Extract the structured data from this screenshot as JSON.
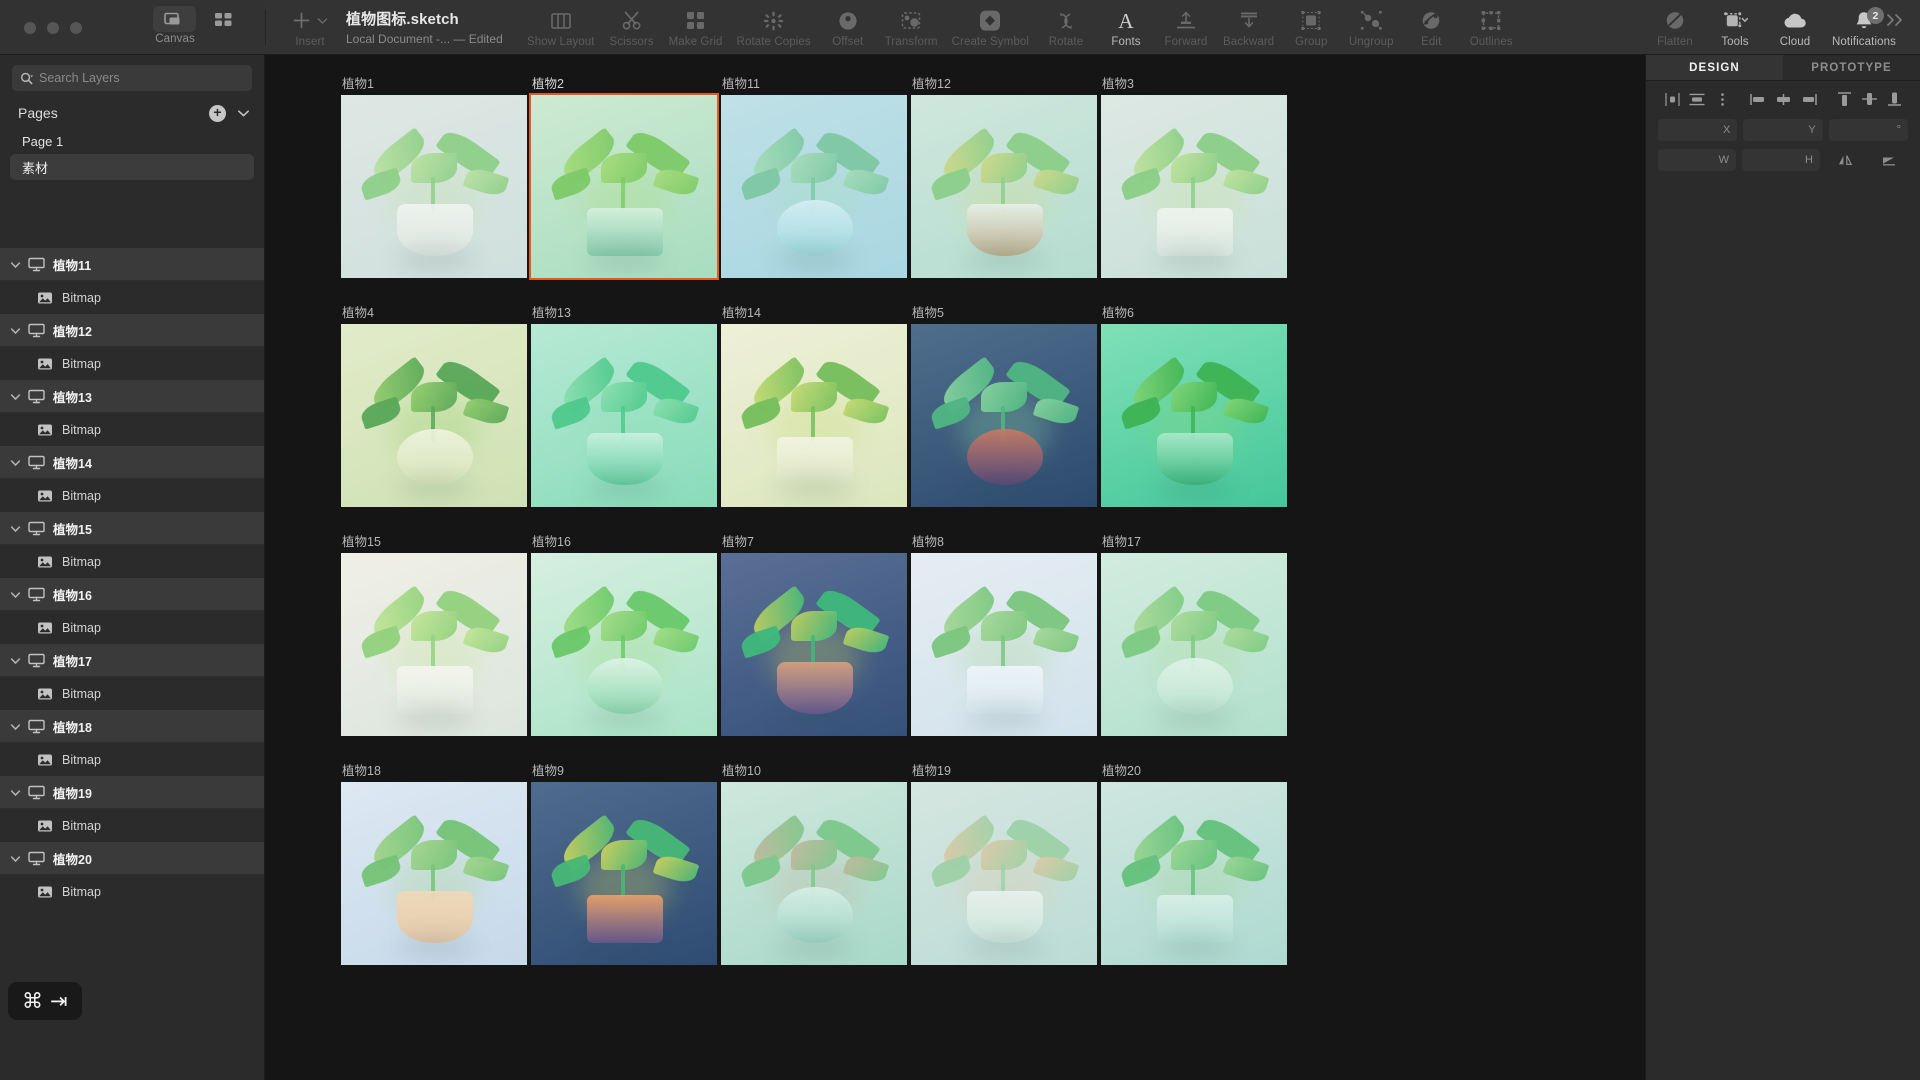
{
  "window": {
    "traffic_lights": [
      "close",
      "minimize",
      "zoom"
    ],
    "canvas_toggle_label": "Canvas"
  },
  "document": {
    "name": "植物图标.sketch",
    "subtitle": "Local Document -... — Edited"
  },
  "toolbar": {
    "insert_label": "Insert",
    "items": [
      {
        "label": "Show Layout",
        "icon": "layout-columns-icon",
        "state": "dim"
      },
      {
        "label": "Scissors",
        "icon": "scissors-icon",
        "state": "dim"
      },
      {
        "label": "Make Grid",
        "icon": "grid-squares-icon",
        "state": "dim"
      },
      {
        "label": "Rotate Copies",
        "icon": "rotate-copies-icon",
        "state": "dim"
      },
      {
        "label": "Offset",
        "icon": "offset-disc-icon",
        "state": "dim"
      },
      {
        "label": "Transform",
        "icon": "transform-icon",
        "state": "dim"
      },
      {
        "label": "Create Symbol",
        "icon": "create-symbol-icon",
        "state": "dim"
      },
      {
        "label": "Rotate",
        "icon": "rotate-arrows-icon",
        "state": "dim"
      },
      {
        "label": "Fonts",
        "icon": "fonts-a-icon",
        "state": "bright"
      },
      {
        "label": "Forward",
        "icon": "move-forward-icon",
        "state": "dim"
      },
      {
        "label": "Backward",
        "icon": "move-backward-icon",
        "state": "dim"
      },
      {
        "label": "Group",
        "icon": "group-icon",
        "state": "dim"
      },
      {
        "label": "Ungroup",
        "icon": "ungroup-icon",
        "state": "dim"
      },
      {
        "label": "Edit",
        "icon": "edit-icon",
        "state": "dim"
      },
      {
        "label": "Outlines",
        "icon": "outlines-icon",
        "state": "dim"
      },
      {
        "label": "Flatten",
        "icon": "flatten-icon",
        "state": "dim"
      },
      {
        "label": "Tools",
        "icon": "tools-icon",
        "state": "bright"
      },
      {
        "label": "Cloud",
        "icon": "cloud-icon",
        "state": "bright"
      },
      {
        "label": "Notifications",
        "icon": "bell-icon",
        "state": "bright",
        "badge": "2"
      }
    ],
    "overflow_icon": "chevron-double-right-icon"
  },
  "sidebar": {
    "search": {
      "placeholder": "Search Layers",
      "icon": "search-icon",
      "value": ""
    },
    "pages": {
      "title": "Pages",
      "add_icon": "plus-circle-icon",
      "collapse_icon": "chevron-down-icon",
      "items": [
        {
          "label": "Page 1",
          "selected": false
        },
        {
          "label": "素材",
          "selected": true
        }
      ]
    },
    "layers": [
      {
        "type": "artboard",
        "label": "植物11"
      },
      {
        "type": "bitmap",
        "label": "Bitmap"
      },
      {
        "type": "artboard",
        "label": "植物12"
      },
      {
        "type": "bitmap",
        "label": "Bitmap"
      },
      {
        "type": "artboard",
        "label": "植物13"
      },
      {
        "type": "bitmap",
        "label": "Bitmap"
      },
      {
        "type": "artboard",
        "label": "植物14"
      },
      {
        "type": "bitmap",
        "label": "Bitmap"
      },
      {
        "type": "artboard",
        "label": "植物15"
      },
      {
        "type": "bitmap",
        "label": "Bitmap"
      },
      {
        "type": "artboard",
        "label": "植物16"
      },
      {
        "type": "bitmap",
        "label": "Bitmap"
      },
      {
        "type": "artboard",
        "label": "植物17"
      },
      {
        "type": "bitmap",
        "label": "Bitmap"
      },
      {
        "type": "artboard",
        "label": "植物18"
      },
      {
        "type": "bitmap",
        "label": "Bitmap"
      },
      {
        "type": "artboard",
        "label": "植物19"
      },
      {
        "type": "bitmap",
        "label": "Bitmap"
      },
      {
        "type": "artboard",
        "label": "植物20"
      },
      {
        "type": "bitmap",
        "label": "Bitmap"
      }
    ],
    "shortcut_overlay": {
      "keys": [
        "⌘",
        "⇥"
      ]
    }
  },
  "canvas": {
    "accent_selection_color": "#e8581c",
    "background_color": "#151515",
    "artboards": [
      {
        "label": "植物1",
        "selected": false,
        "bg1": "#dfe7e4",
        "bg2": "#cfe0dd",
        "leaf": "#8fd08a",
        "leaf2": "#bfe2a8",
        "pot": "#eef3ef",
        "potdark": "#dfe8e2"
      },
      {
        "label": "植物2",
        "selected": true,
        "bg1": "#cdead2",
        "bg2": "#a8ddc0",
        "leaf": "#7ecb6a",
        "leaf2": "#a9dd7e",
        "pot": "#d5f0df",
        "potdark": "#86ccab"
      },
      {
        "label": "植物11",
        "selected": false,
        "bg1": "#bfe0e6",
        "bg2": "#a9d7e2",
        "leaf": "#7fc9a4",
        "leaf2": "#a8ddbd",
        "pot": "#d4eef2",
        "potdark": "#9fd9e0"
      },
      {
        "label": "植物12",
        "selected": false,
        "bg1": "#cfe7dd",
        "bg2": "#b5ddd0",
        "leaf": "#8ccf8c",
        "leaf2": "#d2d98a",
        "pot": "#e7f0e8",
        "potdark": "#bcae8e"
      },
      {
        "label": "植物3",
        "selected": false,
        "bg1": "#dde8e3",
        "bg2": "#c9e0d9",
        "leaf": "#8ccf88",
        "leaf2": "#c3e39f",
        "pot": "#eff4ef",
        "potdark": "#dde9e2"
      },
      {
        "label": "植物4",
        "selected": false,
        "bg1": "#e2ebc9",
        "bg2": "#cfe2b4",
        "leaf": "#5aa859",
        "leaf2": "#97cf6e",
        "pot": "#eef3dd",
        "potdark": "#d8e6bb"
      },
      {
        "label": "植物13",
        "selected": false,
        "bg1": "#b7e9d4",
        "bg2": "#88dcbb",
        "leaf": "#4fc98e",
        "leaf2": "#8fe0b2",
        "pot": "#c8f0df",
        "potdark": "#63cfa0"
      },
      {
        "label": "植物14",
        "selected": false,
        "bg1": "#eef0d8",
        "bg2": "#dbe6bd",
        "leaf": "#76bf5d",
        "leaf2": "#cbdc76",
        "pot": "#f2f4e2",
        "potdark": "#dfe8c4"
      },
      {
        "label": "植物5",
        "selected": false,
        "bg1": "#4f6d8c",
        "bg2": "#2c4a6e",
        "leaf": "#4fb684",
        "leaf2": "#8cd3a0",
        "pot": "#c87a62",
        "potdark": "#5a4a7a"
      },
      {
        "label": "植物6",
        "selected": false,
        "bg1": "#7fe0b7",
        "bg2": "#44c79a",
        "leaf": "#3eb455",
        "leaf2": "#84d777",
        "pot": "#a8e9cb",
        "potdark": "#3db97f"
      },
      {
        "label": "植物15",
        "selected": false,
        "bg1": "#f0efe7",
        "bg2": "#dce6dd",
        "leaf": "#93d27f",
        "leaf2": "#c5e69b",
        "pot": "#f4f6ef",
        "potdark": "#e4ebe0"
      },
      {
        "label": "植物16",
        "selected": false,
        "bg1": "#d6efe0",
        "bg2": "#a9e3c6",
        "leaf": "#6bc96a",
        "leaf2": "#a5de86",
        "pot": "#def3e6",
        "potdark": "#8edab0"
      },
      {
        "label": "植物7",
        "selected": false,
        "bg1": "#5a6f95",
        "bg2": "#35507a",
        "leaf": "#3fb87d",
        "leaf2": "#c9cf5e",
        "pot": "#d6a07e",
        "potdark": "#6a5a92"
      },
      {
        "label": "植物8",
        "selected": false,
        "bg1": "#e5edf2",
        "bg2": "#d2e2ec",
        "leaf": "#7cc77f",
        "leaf2": "#a8d99b",
        "pot": "#eef5f8",
        "potdark": "#d9e9f1"
      },
      {
        "label": "植物17",
        "selected": false,
        "bg1": "#d2ece0",
        "bg2": "#b2e0cc",
        "leaf": "#7ecb84",
        "leaf2": "#aedc9c",
        "pot": "#dff2e8",
        "potdark": "#bfe6d3"
      },
      {
        "label": "植物18",
        "selected": false,
        "bg1": "#dde8f2",
        "bg2": "#c6d9ea",
        "leaf": "#76c478",
        "leaf2": "#a6d68f",
        "pot": "#f0d9b8",
        "potdark": "#e8c9a8"
      },
      {
        "label": "植物9",
        "selected": false,
        "bg1": "#4f6b8e",
        "bg2": "#2e4c72",
        "leaf": "#48b877",
        "leaf2": "#d3d35e",
        "pot": "#e8a06a",
        "potdark": "#6b5a90"
      },
      {
        "label": "植物10",
        "selected": false,
        "bg1": "#cfe7dd",
        "bg2": "#a8d9c9",
        "leaf": "#7ec98c",
        "leaf2": "#c4b8a0",
        "pot": "#d8efe6",
        "potdark": "#a0d6c6"
      },
      {
        "label": "植物19",
        "selected": false,
        "bg1": "#d5e6e0",
        "bg2": "#bcdcd6",
        "leaf": "#9ed2a8",
        "leaf2": "#e0c9a8",
        "pot": "#e6f2ec",
        "potdark": "#cfe6de"
      },
      {
        "label": "植物20",
        "selected": false,
        "bg1": "#cfe6e0",
        "bg2": "#aedad0",
        "leaf": "#65c27d",
        "leaf2": "#9dd694",
        "pot": "#d9efe8",
        "potdark": "#b5e0d6"
      }
    ]
  },
  "inspector": {
    "tabs": [
      {
        "label": "DESIGN",
        "active": true
      },
      {
        "label": "PROTOTYPE",
        "active": false
      }
    ],
    "align_buttons": [
      "align-left-icon",
      "align-center-horizontal-icon",
      "distribute-icon",
      "align-start-icon",
      "align-middle-icon",
      "align-end-icon",
      "align-top-icon",
      "align-center-vertical-icon",
      "align-bottom-icon"
    ],
    "fields": [
      {
        "label": "X",
        "value": ""
      },
      {
        "label": "Y",
        "value": ""
      },
      {
        "label": "°",
        "value": ""
      },
      {
        "label": "W",
        "value": ""
      },
      {
        "label": "H",
        "value": ""
      }
    ],
    "flip_buttons": [
      "flip-horizontal-icon",
      "flip-vertical-icon"
    ]
  }
}
